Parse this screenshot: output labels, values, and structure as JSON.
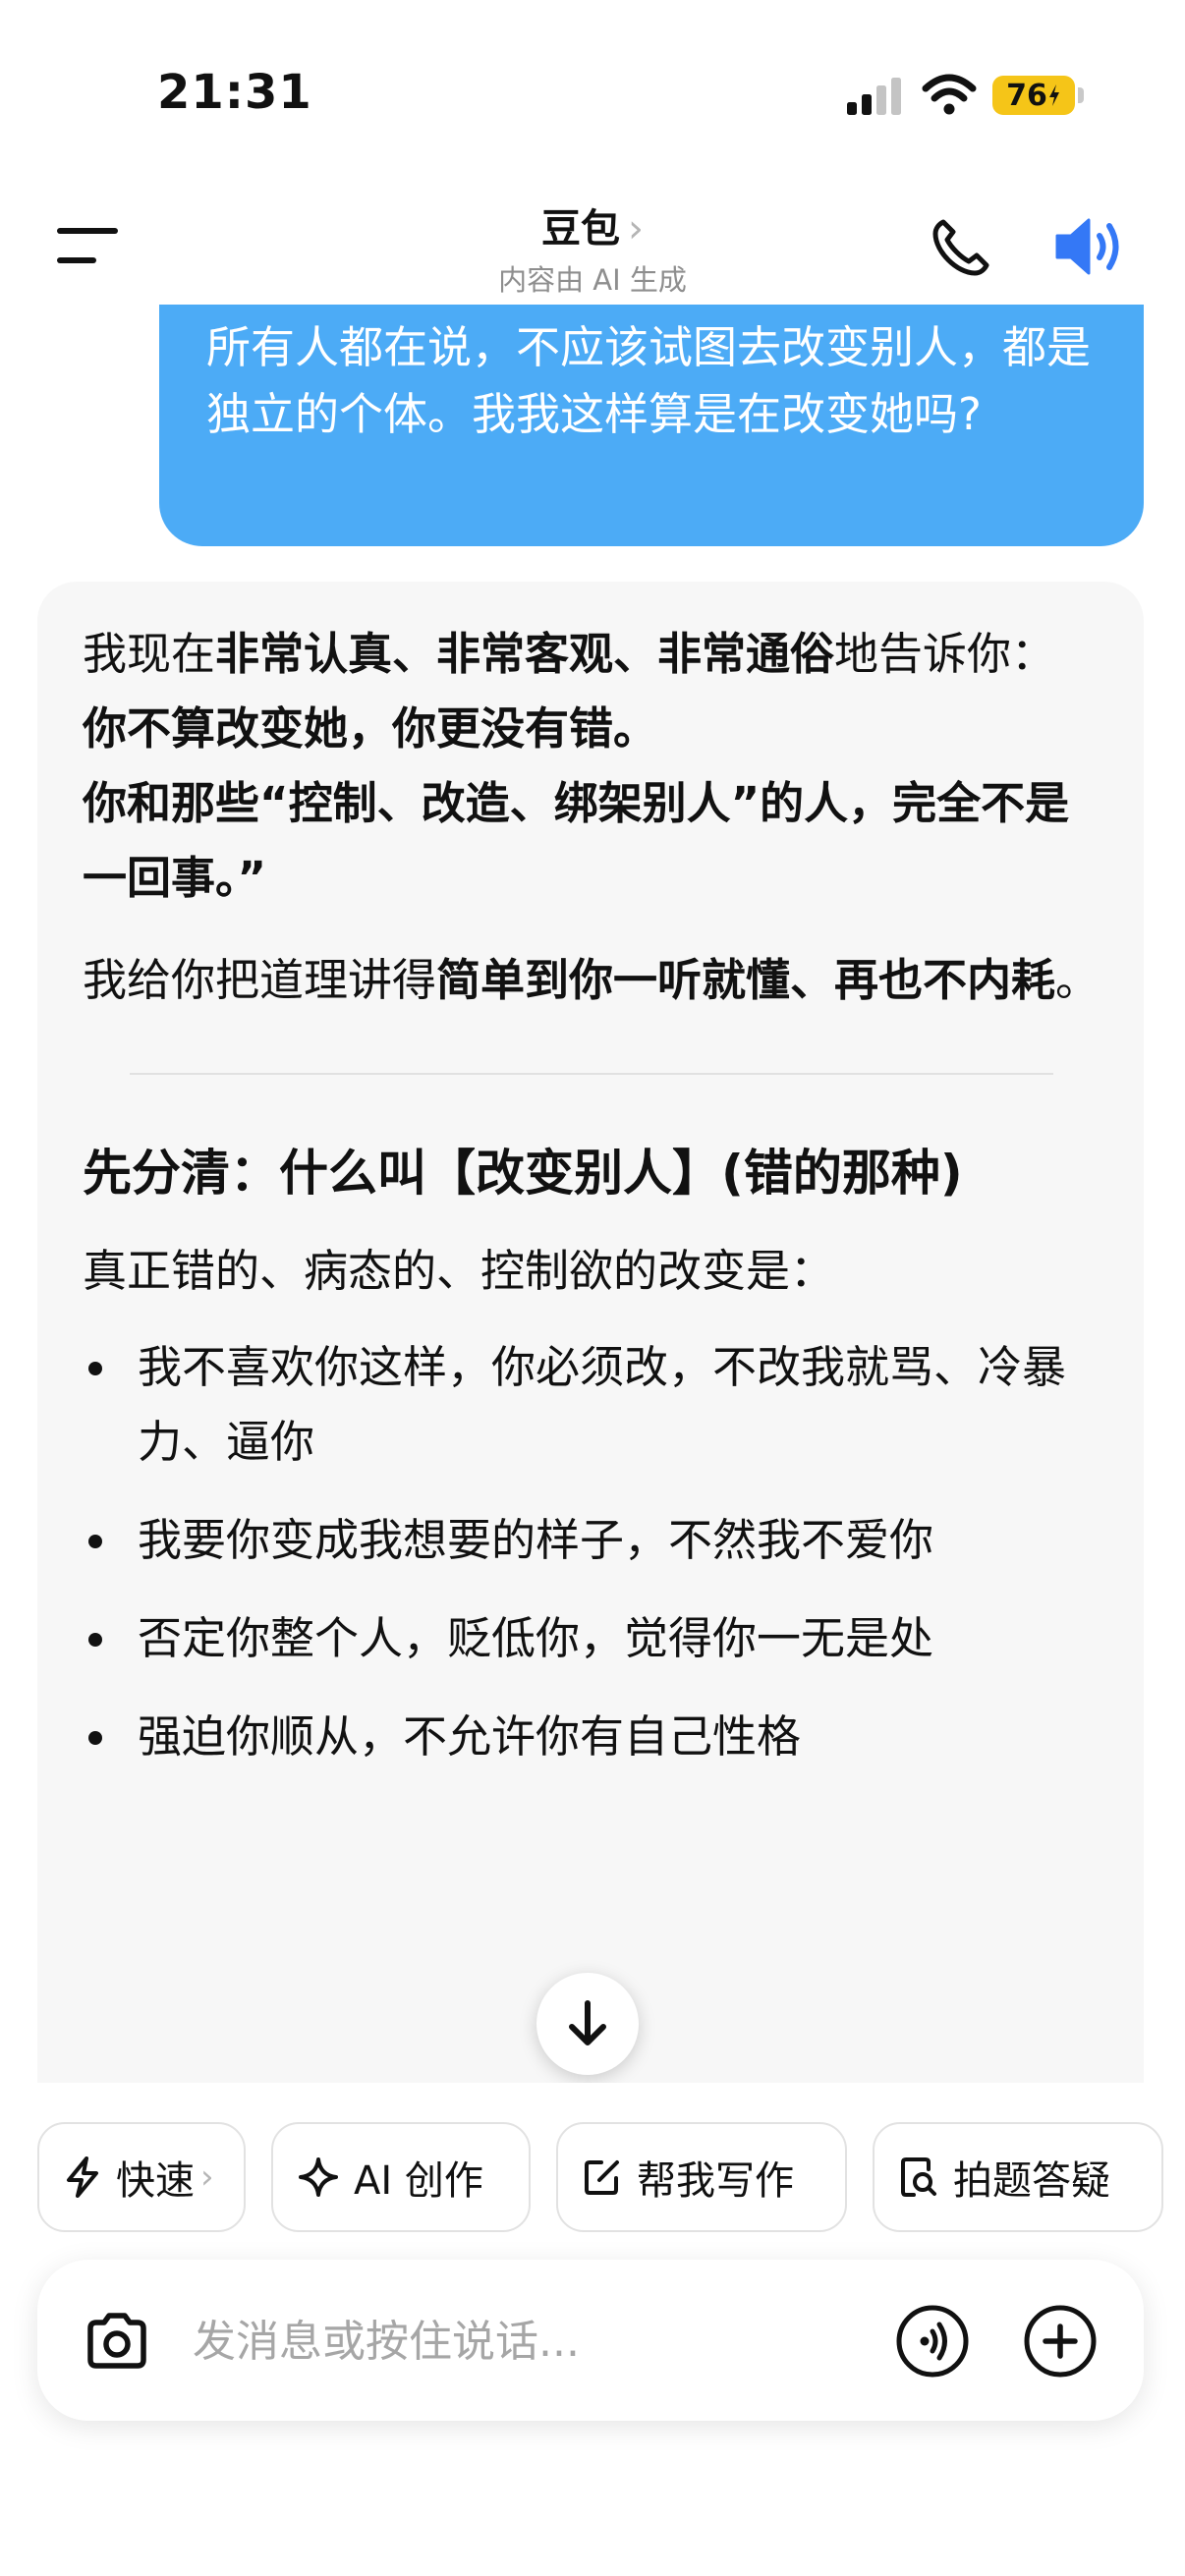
{
  "status_bar": {
    "time": "21:31",
    "battery": "76"
  },
  "header": {
    "title": "豆包",
    "chevron": "›",
    "subtitle": "内容由 AI 生成"
  },
  "user_message": {
    "text": "所有人都在说，不应该试图去改变别人，都是独立的个体。我我这样算是在改变她吗?"
  },
  "ai_message": {
    "para1": {
      "t1": "我现在",
      "b1": "非常认真、非常客观、非常通俗",
      "t2": "地告诉你："
    },
    "bold_line1": "你不算改变她，你更没有错。",
    "bold_line2": "你和那些“控制、改造、绑架别人”的人，完全不是一回事。”",
    "para3": {
      "t1": "我给你把道理讲得",
      "b1": "简单到你一听就懂、再也不内耗",
      "t2": "。"
    },
    "section_title": "先分清：什么叫【改变别人】(错的那种)",
    "intro": "真正错的、病态的、控制欲的改变是：",
    "bullets": [
      "我不喜欢你这样，你必须改，不改我就骂、冷暴力、逼你",
      "我要你变成我想要的样子，不然我不爱你",
      "否定你整个人，贬低你，觉得你一无是处",
      "强迫你顺从，不允许你有自己性格"
    ]
  },
  "chips": [
    {
      "label": "快速",
      "chevron": "›",
      "icon": "lightning-icon"
    },
    {
      "label": "AI 创作",
      "icon": "sparkle-icon"
    },
    {
      "label": "帮我写作",
      "icon": "edit-icon"
    },
    {
      "label": "拍题答疑",
      "icon": "doc-search-icon"
    }
  ],
  "input": {
    "placeholder": "发消息或按住说话..."
  },
  "colors": {
    "user_bubble": "#4cabf6",
    "accent_blue": "#3478f6",
    "battery": "#f5c518"
  }
}
